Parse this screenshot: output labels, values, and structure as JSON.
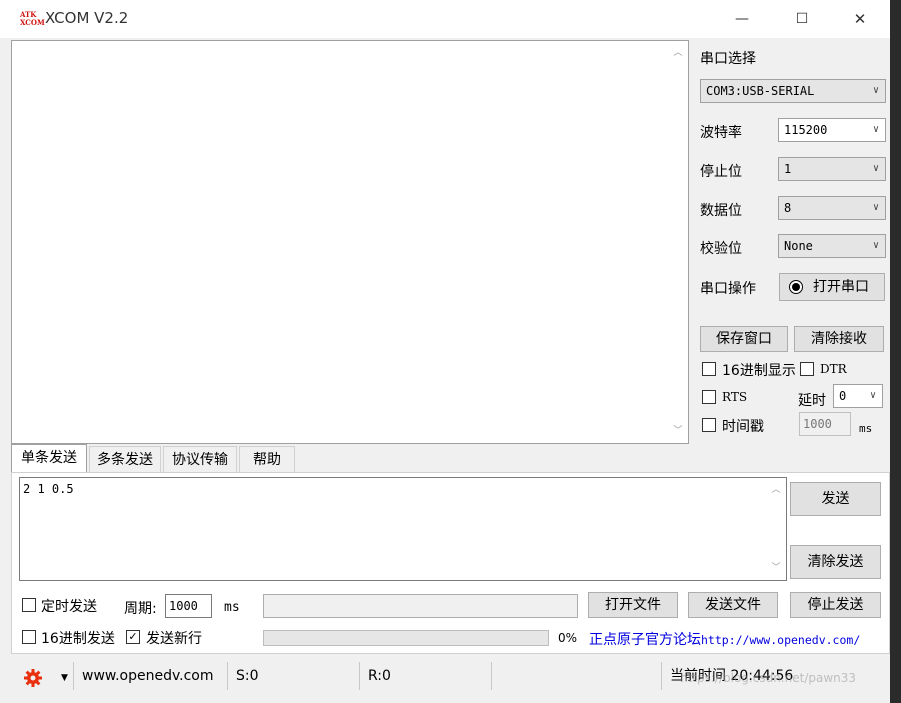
{
  "window": {
    "title": "XCOM V2.2",
    "logo_text_top": "ATK",
    "logo_text_bottom": "XCOM",
    "minimize_glyph": "—",
    "maximize_glyph": "☐",
    "close_glyph": "✕"
  },
  "serial": {
    "section_title": "串口选择",
    "port": "COM3:USB-SERIAL",
    "baud_label": "波特率",
    "baud": "115200",
    "stopbits_label": "停止位",
    "stopbits": "1",
    "databits_label": "数据位",
    "databits": "8",
    "parity_label": "校验位",
    "parity": "None",
    "op_label": "串口操作",
    "open_button": "打开串口"
  },
  "rx_controls": {
    "save_button": "保存窗口",
    "clear_button": "清除接收",
    "hex_display": "16进制显示",
    "dtr": "DTR",
    "rts": "RTS",
    "delay_label": "延时",
    "delay_value": "0",
    "timestamp": "时间戳",
    "timestamp_ms_value": "1000",
    "ms_unit": "ms"
  },
  "tabs": [
    "单条发送",
    "多条发送",
    "协议传输",
    "帮助"
  ],
  "send": {
    "tx_text": "2 1 0.5",
    "send_button": "发送",
    "clear_send_button": "清除发送",
    "timed_send": "定时发送",
    "period_label": "周期:",
    "period_value": "1000",
    "period_unit": "ms",
    "open_file_button": "打开文件",
    "send_file_button": "发送文件",
    "stop_send_button": "停止发送",
    "hex_send": "16进制发送",
    "newline": "发送新行",
    "progress_text": "0%",
    "progress": 0,
    "forum_link_cn": "正点原子官方论坛",
    "forum_link_url": "http://www.openedv.com/"
  },
  "statusbar": {
    "site": "www.openedv.com",
    "sent": "S:0",
    "received": "R:0",
    "time": "当前时间 20:44:56",
    "watermark": "https://blog.csdn.net/pawn33"
  },
  "colors": {
    "gear": "#e8300f",
    "link_cn": "#0000e0",
    "link_url": "#0000e0"
  }
}
